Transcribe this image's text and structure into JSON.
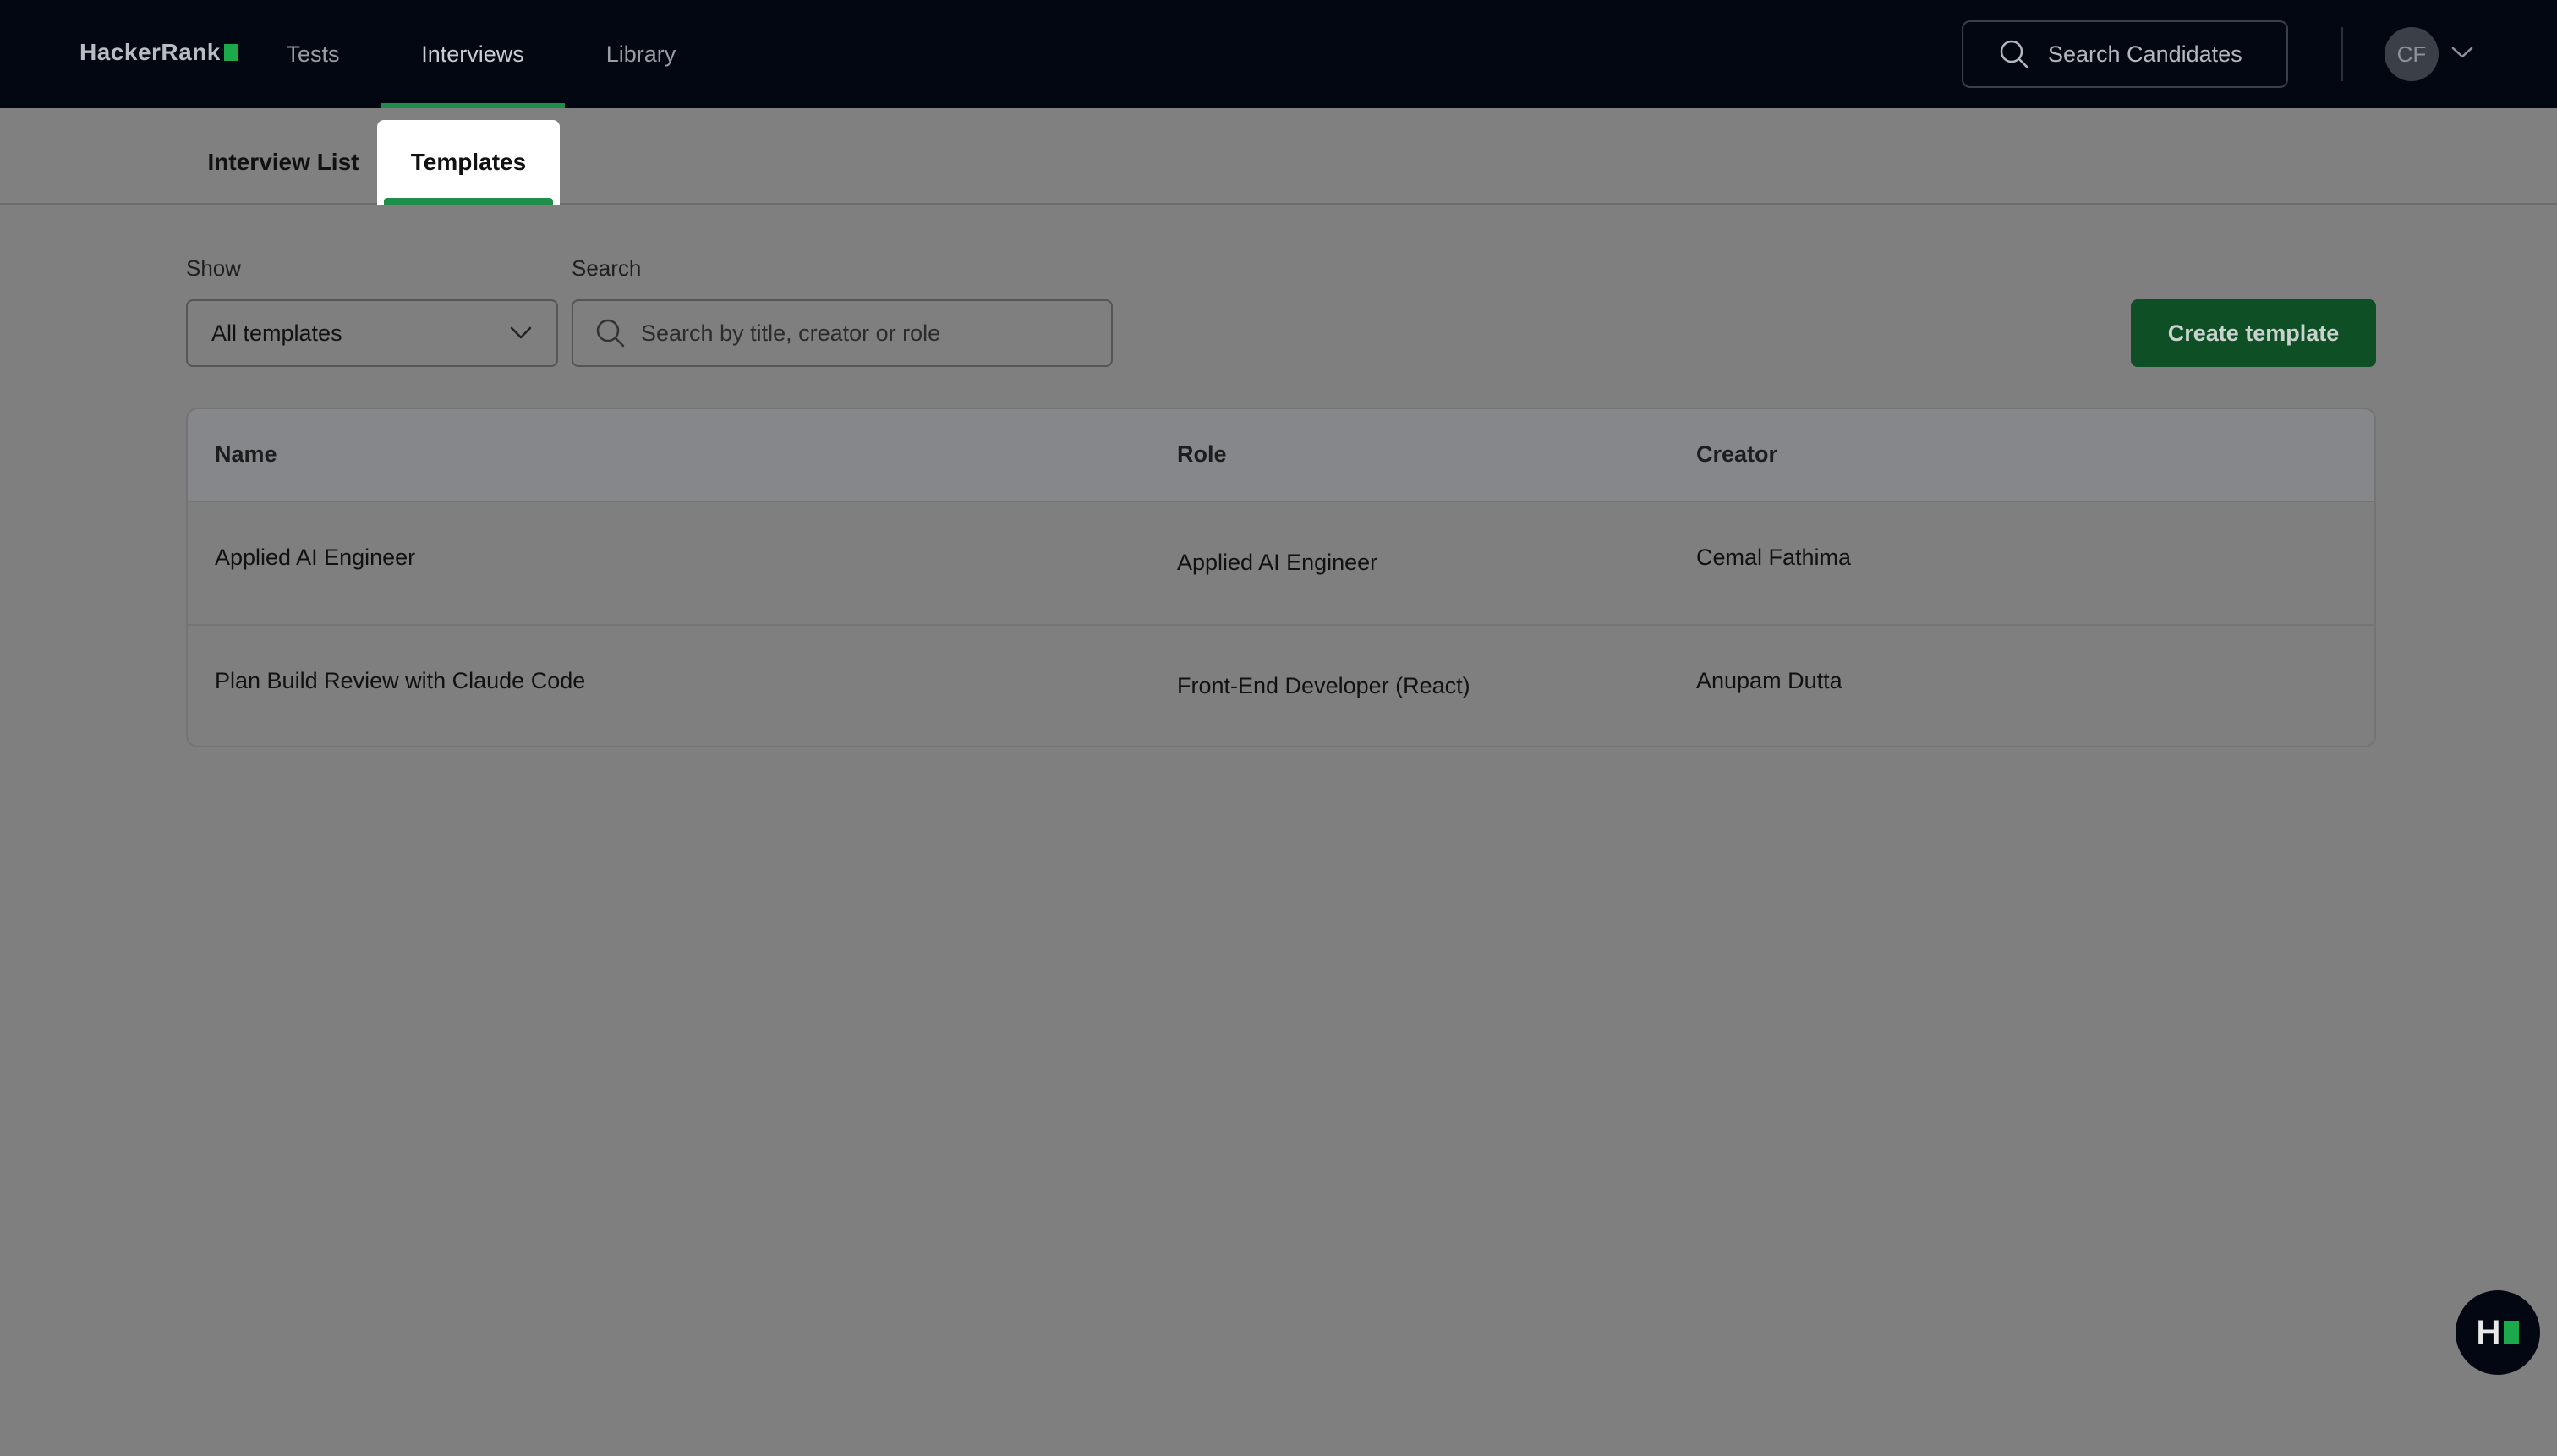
{
  "header": {
    "logo_text": "HackerRank",
    "nav": [
      {
        "label": "Tests",
        "active": false
      },
      {
        "label": "Interviews",
        "active": true
      },
      {
        "label": "Library",
        "active": false
      }
    ],
    "search_candidates_label": "Search Candidates",
    "avatar_initials": "CF"
  },
  "subnav": {
    "tabs": [
      {
        "label": "Interview List",
        "active": false
      },
      {
        "label": "Templates",
        "active": true
      }
    ]
  },
  "filters": {
    "show_label": "Show",
    "show_value": "All templates",
    "search_label": "Search",
    "search_placeholder": "Search by title, creator or role",
    "search_value": ""
  },
  "create_button_label": "Create template",
  "table": {
    "columns": [
      "Name",
      "Role",
      "Creator"
    ],
    "rows": [
      {
        "name": "Applied AI Engineer",
        "role": "Applied AI Engineer",
        "creator": "Cemal Fathima"
      },
      {
        "name": "Plan Build Review with Claude Code",
        "role": "Front-End Developer (React)",
        "creator": "Anupam Dutta"
      }
    ]
  },
  "help_fab_label": "H",
  "colors": {
    "topbar_bg": "#020712",
    "accent_green": "#1e8e4a",
    "button_green": "#0e4f26",
    "overlay_gray": "#7f7f7f"
  }
}
